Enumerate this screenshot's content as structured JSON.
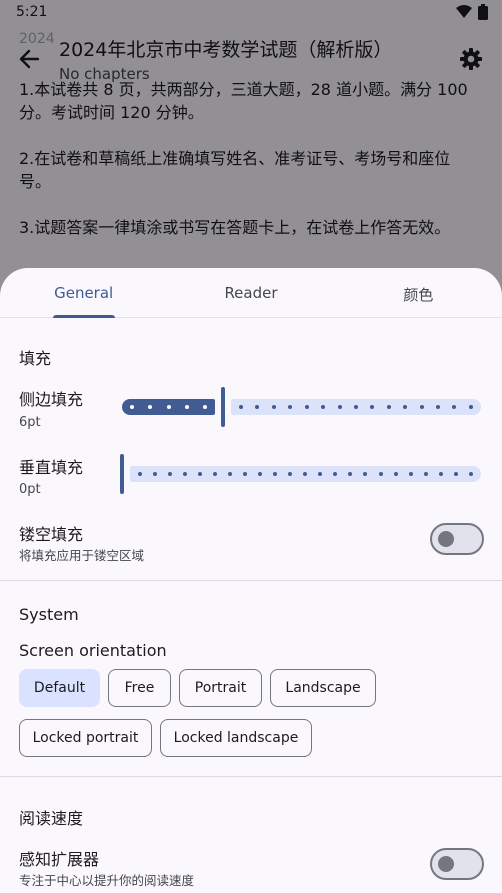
{
  "status": {
    "time": "5:21"
  },
  "appbar": {
    "title": "2024年北京市中考数学试题（解析版）",
    "subtitle": "No chapters"
  },
  "page": {
    "faded_line": "2024",
    "paragraphs": [
      "1.本试卷共 8 页，共两部分，三道大题，28 道小题。满分 100 分。考试时间 120 分钟。",
      "2.在试卷和草稿纸上准确填写姓名、准考证号、考场号和座位号。",
      "3.试题答案一律填涂或书写在答题卡上，在试卷上作答无效。"
    ]
  },
  "tabs": [
    {
      "label": "General",
      "active": true
    },
    {
      "label": "Reader",
      "active": false
    },
    {
      "label": "颜色",
      "active": false
    }
  ],
  "padding": {
    "title": "填充",
    "side": {
      "label": "侧边填充",
      "value_text": "6pt",
      "fraction": 0.28
    },
    "vertical": {
      "label": "垂直填充",
      "value_text": "0pt",
      "fraction": 0.0
    },
    "cutout": {
      "label": "镂空填充",
      "description": "将填充应用于镂空区域",
      "enabled": false
    }
  },
  "system": {
    "title": "System",
    "orientation_label": "Screen orientation",
    "options": [
      {
        "label": "Default",
        "selected": true
      },
      {
        "label": "Free",
        "selected": false
      },
      {
        "label": "Portrait",
        "selected": false
      },
      {
        "label": "Landscape",
        "selected": false
      },
      {
        "label": "Locked portrait",
        "selected": false
      },
      {
        "label": "Locked landscape",
        "selected": false
      }
    ]
  },
  "reading_speed": {
    "title": "阅读速度",
    "bionic": {
      "label": "感知扩展器",
      "description": "专注于中心以提升你的阅读速度",
      "enabled": false
    }
  },
  "colors": {
    "accent": "#415b93",
    "track_inactive": "#dce2f9",
    "chip_selected": "#dae2ff"
  },
  "icons": [
    "back-arrow-icon",
    "settings-gear-icon",
    "wifi-icon",
    "battery-icon"
  ]
}
